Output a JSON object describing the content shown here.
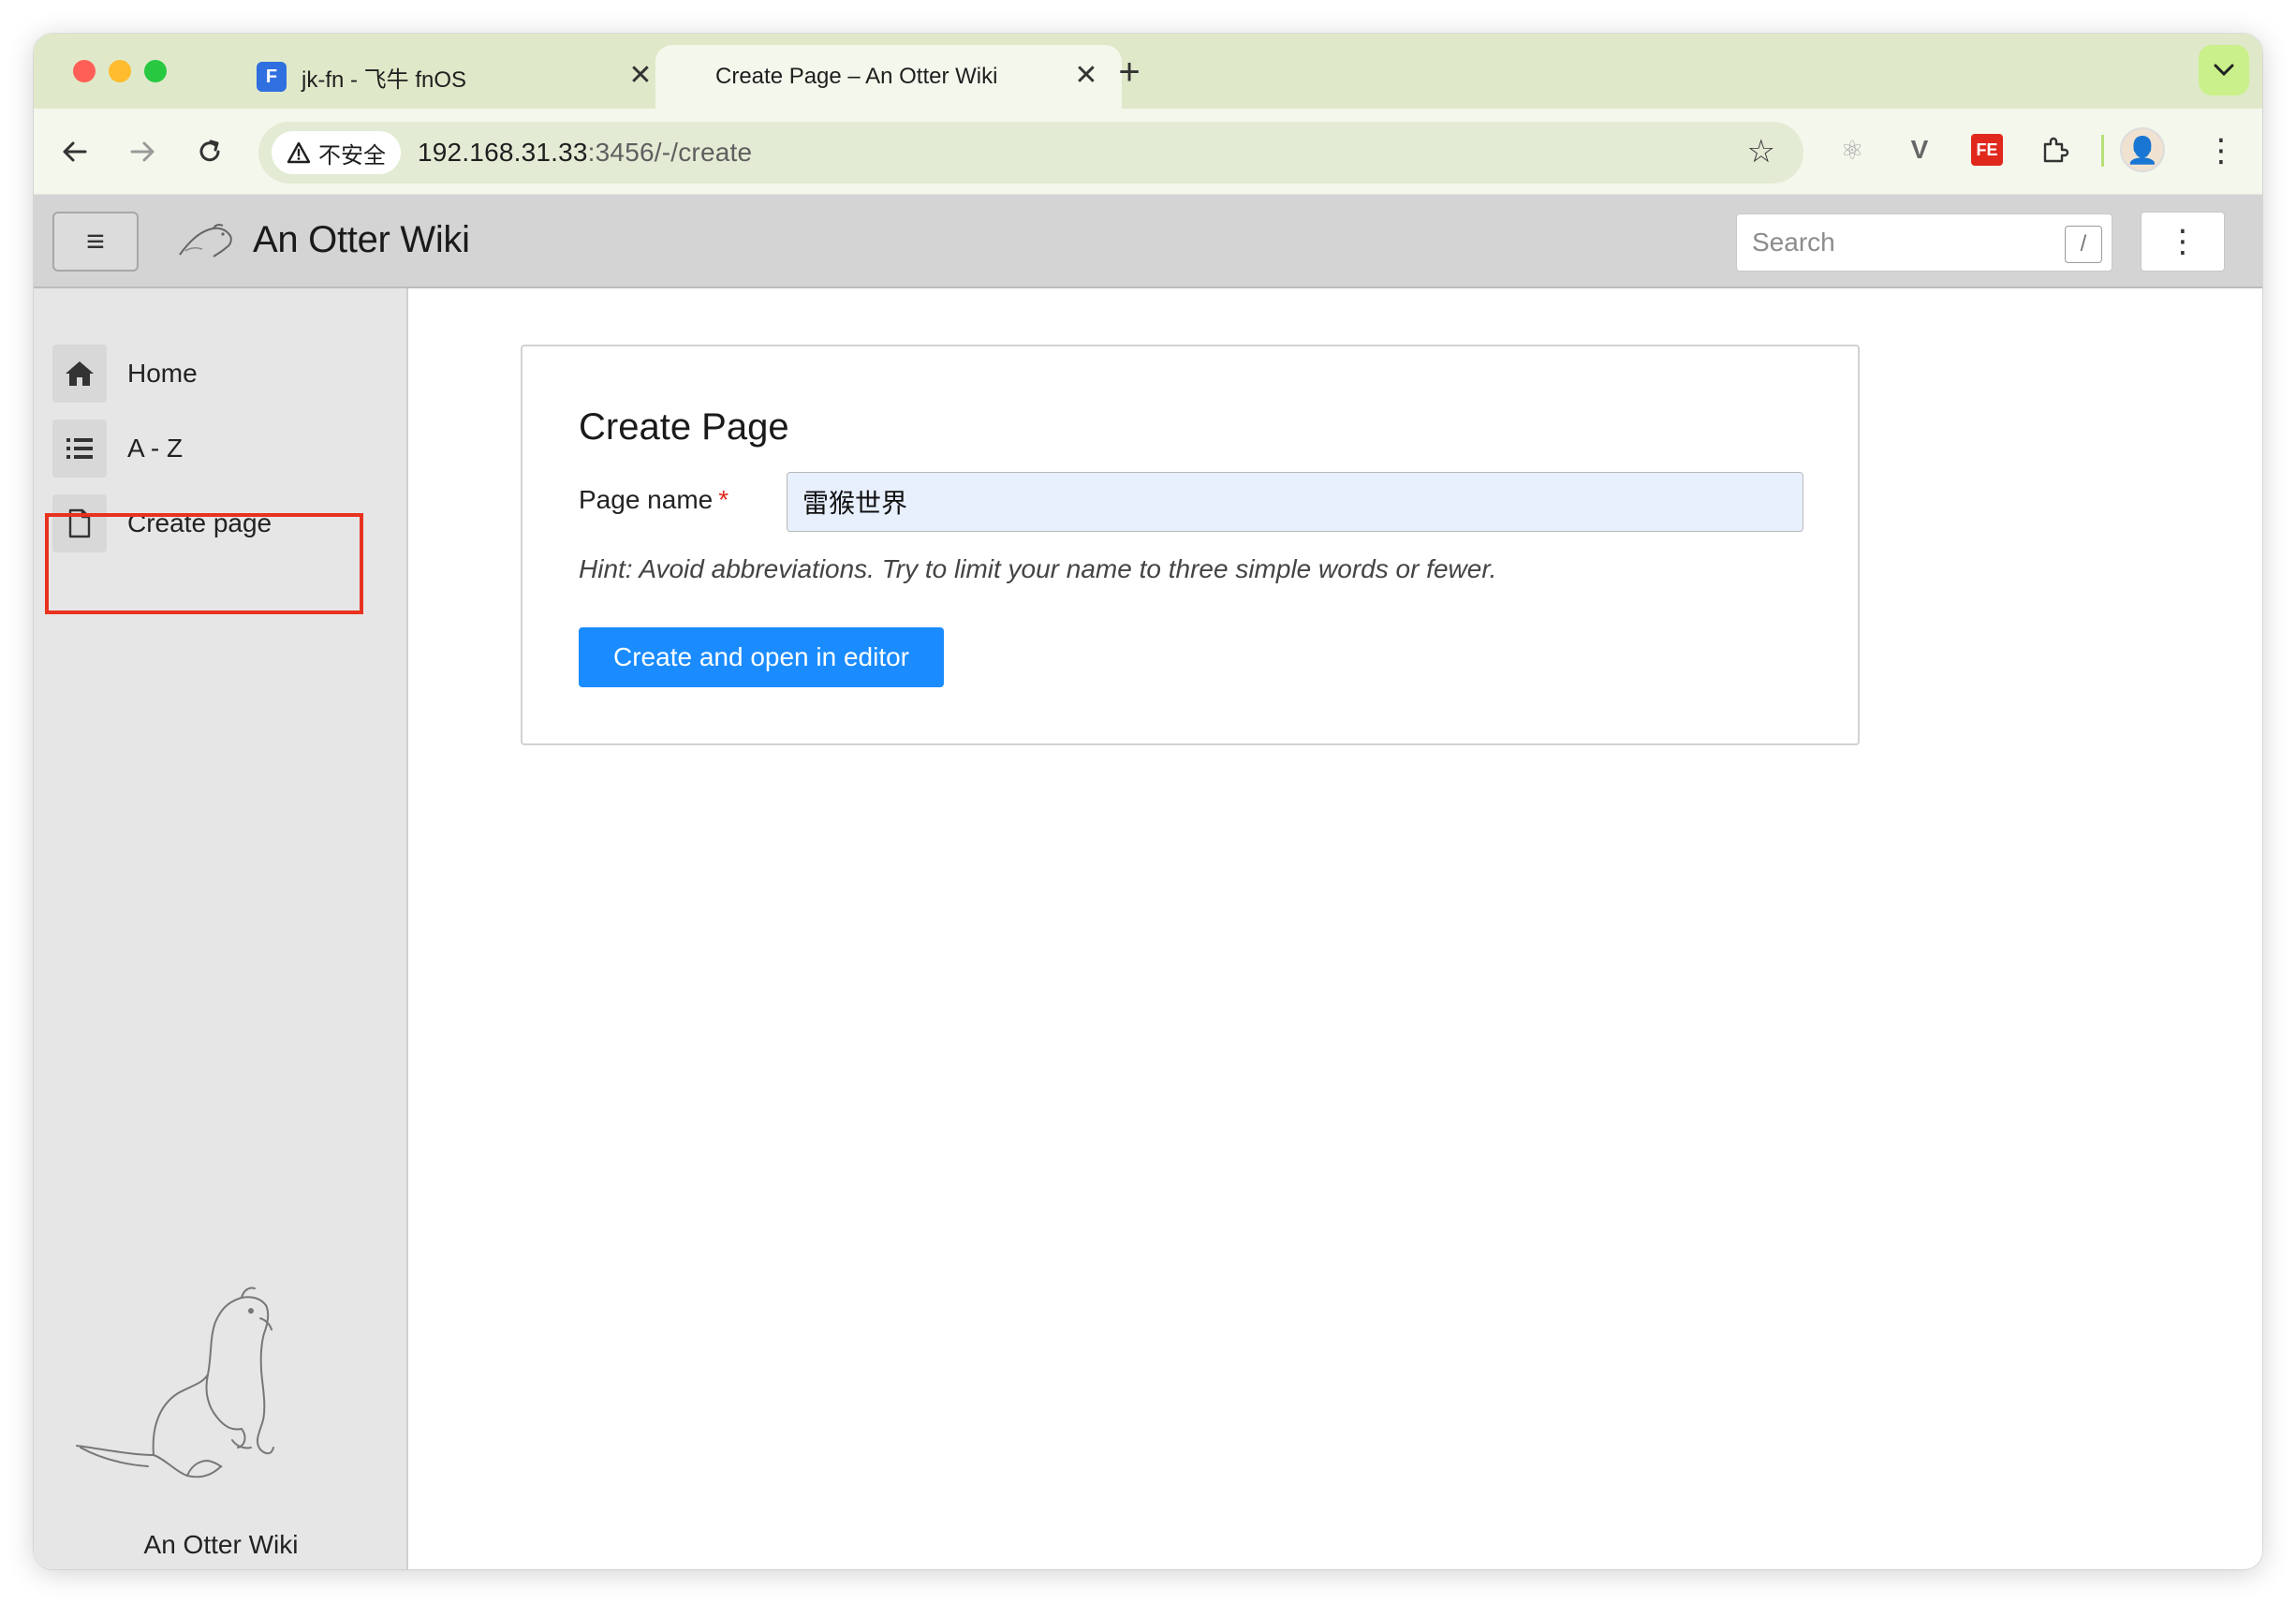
{
  "browser": {
    "tabs": [
      {
        "title": "jk-fn - 飞牛 fnOS",
        "close": "✕"
      },
      {
        "title": "Create Page – An Otter Wiki",
        "close": "✕"
      }
    ],
    "new_tab": "+",
    "security_label": "不安全",
    "url_host": "192.168.31.33",
    "url_path": ":3456/-/create"
  },
  "app": {
    "title": "An Otter Wiki",
    "search_placeholder": "Search",
    "search_shortcut": "/"
  },
  "sidebar": {
    "items": [
      {
        "label": "Home",
        "icon": "home-icon"
      },
      {
        "label": "A - Z",
        "icon": "list-icon"
      },
      {
        "label": "Create page",
        "icon": "file-icon"
      }
    ],
    "footer": "An Otter Wiki"
  },
  "form": {
    "title": "Create Page",
    "page_name_label": "Page name",
    "required_mark": "*",
    "page_name_value": "雷猴世界",
    "hint": "Hint: Avoid abbreviations. Try to limit your name to three simple words or fewer.",
    "submit_label": "Create and open in editor"
  },
  "colors": {
    "primary_button": "#1a8cff",
    "highlight": "#e8321f",
    "tab_strip": "#dfe9c9"
  }
}
